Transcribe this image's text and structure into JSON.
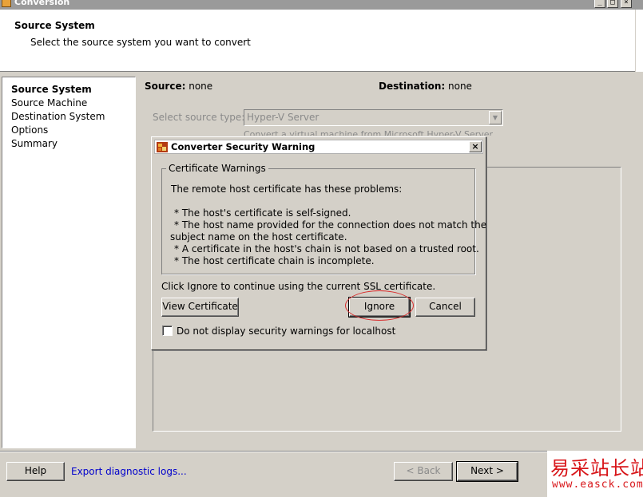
{
  "window": {
    "title": "Conversion",
    "controls": [
      "_",
      "□",
      "×"
    ]
  },
  "header": {
    "title": "Source System",
    "subtitle": "Select the source system you want to convert"
  },
  "nav": {
    "items": [
      {
        "label": "Source System",
        "active": true
      },
      {
        "label": "Source Machine",
        "active": false
      },
      {
        "label": "Destination System",
        "active": false
      },
      {
        "label": "Options",
        "active": false
      },
      {
        "label": "Summary",
        "active": false
      }
    ]
  },
  "main": {
    "source_label": "Source:",
    "source_value": "none",
    "destination_label": "Destination:",
    "destination_value": "none",
    "select_source_type_label": "Select source type:",
    "select_source_type_value": "Hyper-V Server",
    "source_type_description": "Convert a virtual machine from Microsoft Hyper-V Server"
  },
  "dialog": {
    "title": "Converter Security Warning",
    "icon": "converter-app-icon",
    "group_title": "Certificate Warnings",
    "intro": "The remote host certificate has these problems:",
    "problems": [
      "* The host's certificate is self-signed.",
      "* The host name provided for the connection does not match the",
      "subject name on the host certificate.",
      "* A certificate in the host's chain is not based on a trusted root.",
      "* The host certificate chain is incomplete."
    ],
    "instruction": "Click Ignore to continue using the current SSL certificate.",
    "view_certificate_label": "View Certificate",
    "ignore_label": "Ignore",
    "cancel_label": "Cancel",
    "checkbox_label": "Do not display security warnings for localhost",
    "checkbox_checked": false,
    "highlight_color": "#d83030"
  },
  "footer": {
    "help_label": "Help",
    "export_logs_label": "Export diagnostic logs...",
    "back_label": "< Back",
    "next_label": "Next >"
  },
  "watermark": {
    "chinese": "易采站长站",
    "url": "www.easck.com",
    "color": "#d8161a"
  }
}
